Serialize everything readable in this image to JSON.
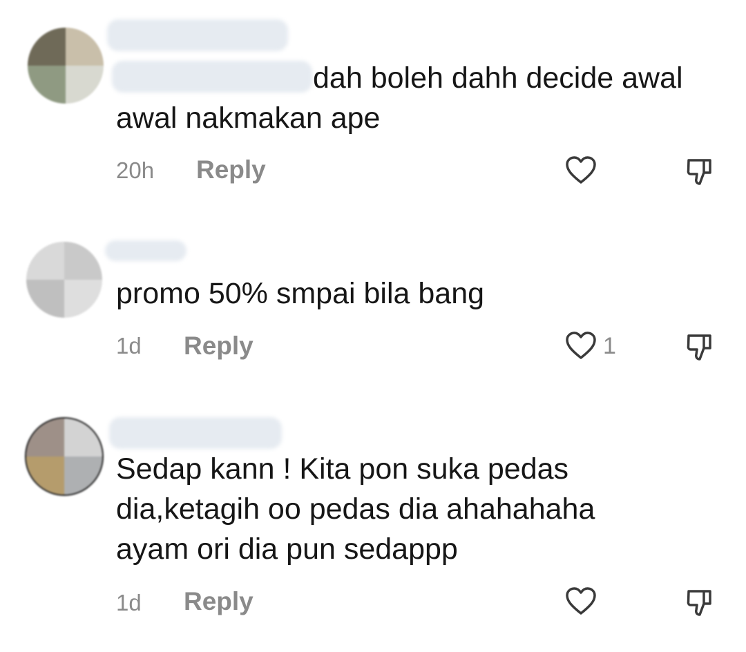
{
  "comments": [
    {
      "text": "dah boleh dahh decide awal\nawal nakmakan ape",
      "time": "20h",
      "reply_label": "Reply",
      "like_count": ""
    },
    {
      "text": "promo 50% smpai bila bang",
      "time": "1d",
      "reply_label": "Reply",
      "like_count": "1"
    },
    {
      "text": "Sedap kann ! Kita pon suka pedas\ndia,ketagih oo pedas dia ahahahaha\nayam ori dia pun sedappp",
      "time": "1d",
      "reply_label": "Reply",
      "like_count": ""
    }
  ],
  "icons": {
    "like": "heart-outline-icon",
    "dislike": "thumbs-down-outline-icon"
  },
  "colors": {
    "text": "#161616",
    "meta": "#8a8a8a",
    "icon": "#3a3a3a"
  }
}
